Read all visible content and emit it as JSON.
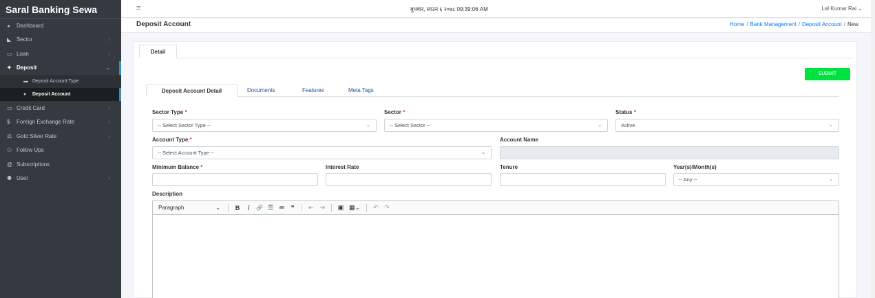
{
  "sidebar": {
    "brand": "Saral Banking Sewa",
    "items": [
      {
        "label": "Dashboard"
      },
      {
        "label": "Sector"
      },
      {
        "label": "Loan"
      },
      {
        "label": "Deposit"
      },
      {
        "label": "Credit Card"
      },
      {
        "label": "Foreign Exchange Rate"
      },
      {
        "label": "Gold Silver Rate"
      },
      {
        "label": "Follow Ups"
      },
      {
        "label": "Subscriptions"
      },
      {
        "label": "User"
      }
    ],
    "deposit_sub": [
      {
        "label": "Deposit Account Type"
      },
      {
        "label": "Deposit Account"
      }
    ],
    "chev_right": "›",
    "chev_down": "⌄"
  },
  "topbar": {
    "menu_icon": "≡",
    "datetime": "बुधवार, साउन ६ २०७८ 09:39:06 AM",
    "user": "Lal Kumar Rai ⌄"
  },
  "header": {
    "title": "Deposit Account",
    "breadcrumb": [
      "Home",
      "Bank Management",
      "Deposit Account",
      "New"
    ],
    "sep": "/"
  },
  "card": {
    "tab": "Detail",
    "submit": "SUBMIT",
    "inner_tabs": [
      "Deposit Account Detail",
      "Documents",
      "Features",
      "Meta Tags"
    ]
  },
  "form": {
    "required_mark": "*",
    "sector_type": {
      "label": "Sector Type",
      "value": "-- Select Sector Type --"
    },
    "sector": {
      "label": "Sector",
      "value": "-- Select Sector --"
    },
    "status": {
      "label": "Status",
      "value": "Active"
    },
    "account_type": {
      "label": "Account Type",
      "value": "-- Select Account Type --"
    },
    "account_name": {
      "label": "Account Name",
      "value": ""
    },
    "min_balance": {
      "label": "Minimum Balance",
      "value": ""
    },
    "interest_rate": {
      "label": "Interest Rate",
      "value": ""
    },
    "tenure": {
      "label": "Tenure",
      "value": ""
    },
    "year_month": {
      "label": "Year(s)/Month(s)",
      "value": "-- Any --"
    },
    "description": {
      "label": "Description"
    },
    "caret": "⌄"
  },
  "editor": {
    "paragraph": "Paragraph",
    "paragraph_caret": "⌄",
    "bold": "B",
    "italic": "I",
    "link": "🔗",
    "bullet_list": "☰",
    "numbered_list": "≔",
    "quote": "❝",
    "outdent": "⇤",
    "indent": "⇥",
    "image": "▣",
    "table": "▦⌄",
    "undo": "↶",
    "redo": "↷"
  }
}
